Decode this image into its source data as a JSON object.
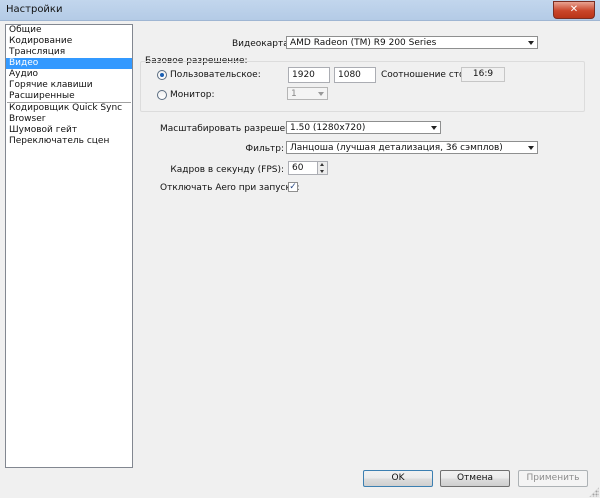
{
  "window": {
    "title": "Настройки",
    "close_glyph": "✕"
  },
  "sidebar": {
    "items": [
      {
        "label": "Общие",
        "selected": false
      },
      {
        "label": "Кодирование",
        "selected": false
      },
      {
        "label": "Трансляция",
        "selected": false
      },
      {
        "label": "Видео",
        "selected": true
      },
      {
        "label": "Аудио",
        "selected": false
      },
      {
        "label": "Горячие клавиши",
        "selected": false
      },
      {
        "label": "Расширенные",
        "selected": false
      }
    ],
    "plugins": [
      {
        "label": "Кодировщик Quick Sync"
      },
      {
        "label": "Browser"
      },
      {
        "label": "Шумовой гейт"
      },
      {
        "label": "Переключатель сцен"
      }
    ]
  },
  "video": {
    "adapter_label": "Видеокарта:",
    "adapter_value": "AMD Radeon (TM) R9 200 Series",
    "base_res_group": "Базовое разрешение:",
    "custom_label": "Пользовательское:",
    "custom_width": "1920",
    "custom_height": "1080",
    "aspect_label": "Соотношение сторон:",
    "aspect_value": "16:9",
    "monitor_label": "Монитор:",
    "monitor_value": "1",
    "scale_label": "Масштабировать разрешение:",
    "scale_value": "1.50  (1280x720)",
    "filter_label": "Фильтр:",
    "filter_value": "Ланцоша (лучшая детализация, 36 сэмплов)",
    "fps_label": "Кадров в секунду (FPS):",
    "fps_value": "60",
    "aero_label": "Отключать Aero при запуске:",
    "aero_checked": true,
    "aero_check_glyph": "✓"
  },
  "buttons": {
    "ok": "OK",
    "cancel": "Отмена",
    "apply": "Применить"
  }
}
